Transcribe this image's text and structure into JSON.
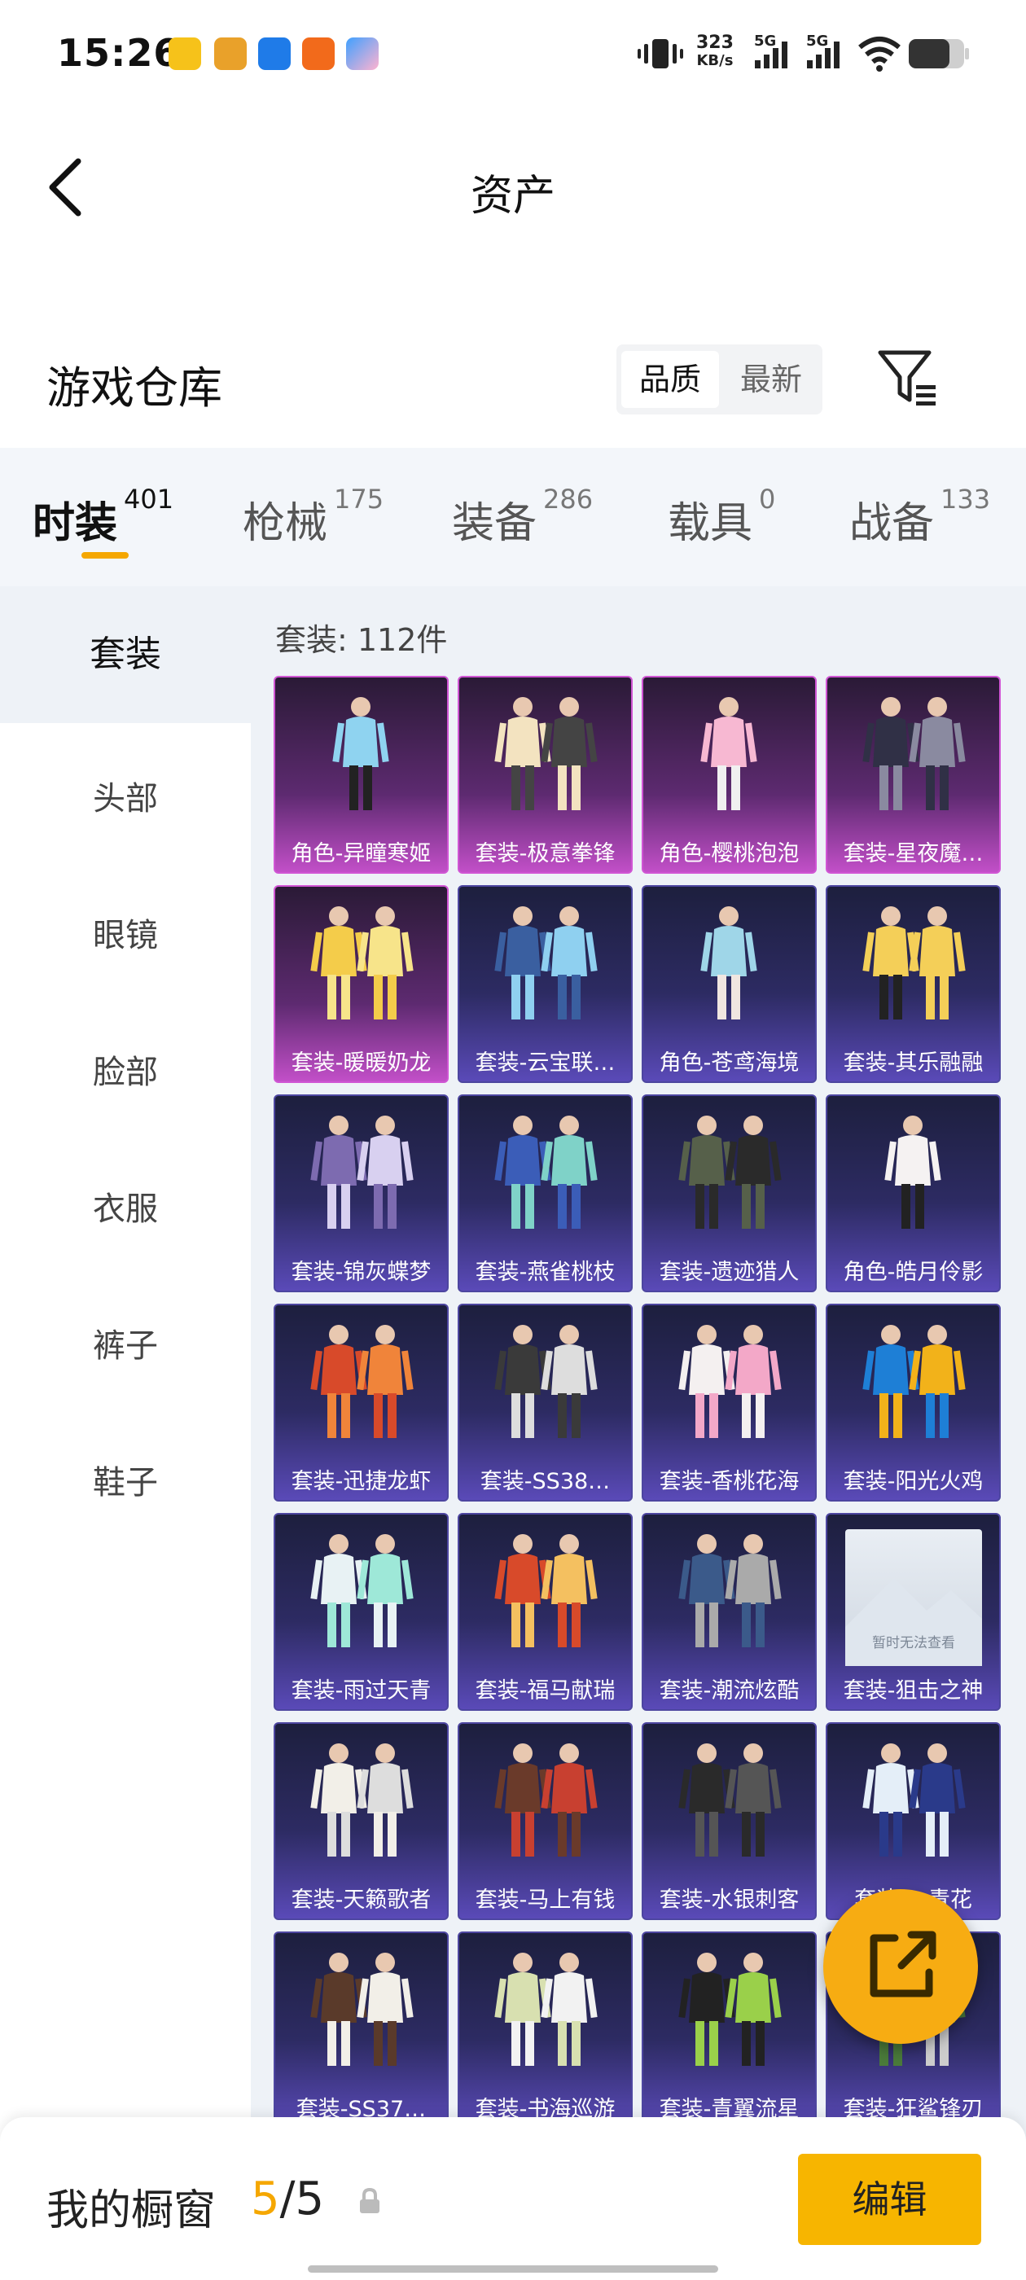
{
  "status_bar": {
    "time": "15:26",
    "net_speed_value": "323",
    "net_speed_unit": "KB/s",
    "sim1": "5G",
    "sim2": "5G",
    "app_icons": [
      "app-icon-yellow",
      "app-icon-game",
      "app-icon-blue",
      "app-icon-orange",
      "app-icon-baidu"
    ]
  },
  "header": {
    "back_icon": "chevron-left-icon",
    "title": "资产"
  },
  "section": {
    "title": "游戏仓库",
    "sort_options": [
      "品质",
      "最新"
    ],
    "sort_selected": "品质",
    "filter_icon": "filter-icon"
  },
  "category_tabs": [
    {
      "label": "时装",
      "count": "401"
    },
    {
      "label": "枪械",
      "count": "175"
    },
    {
      "label": "装备",
      "count": "286"
    },
    {
      "label": "载具",
      "count": "0"
    },
    {
      "label": "战备",
      "count": "133"
    }
  ],
  "selected_category": "时装",
  "sidebar": {
    "items": [
      "套装",
      "头部",
      "眼镜",
      "脸部",
      "衣服",
      "裤子",
      "鞋子"
    ],
    "selected": "套装"
  },
  "content": {
    "count_label": "套装: 112件",
    "placeholder_text": "暂时无法查看",
    "items": [
      {
        "name": "角色-异瞳寒姬",
        "rarity": "purple"
      },
      {
        "name": "套装-极意拳锋",
        "rarity": "purple"
      },
      {
        "name": "角色-樱桃泡泡",
        "rarity": "purple"
      },
      {
        "name": "套装-星夜魔…",
        "rarity": "purple"
      },
      {
        "name": "套装-暖暖奶龙",
        "rarity": "purple"
      },
      {
        "name": "套装-云宝联…",
        "rarity": "blue"
      },
      {
        "name": "角色-苍鸢海境",
        "rarity": "blue"
      },
      {
        "name": "套装-其乐融融",
        "rarity": "blue"
      },
      {
        "name": "套装-锦灰蝶梦",
        "rarity": "blue"
      },
      {
        "name": "套装-燕雀桃枝",
        "rarity": "blue"
      },
      {
        "name": "套装-遗迹猎人",
        "rarity": "blue"
      },
      {
        "name": "角色-皓月伶影",
        "rarity": "blue"
      },
      {
        "name": "套装-迅捷龙虾",
        "rarity": "blue"
      },
      {
        "name": "套装-SS38…",
        "rarity": "blue"
      },
      {
        "name": "套装-香桃花海",
        "rarity": "blue"
      },
      {
        "name": "套装-阳光火鸡",
        "rarity": "blue"
      },
      {
        "name": "套装-雨过天青",
        "rarity": "blue"
      },
      {
        "name": "套装-福马献瑞",
        "rarity": "blue"
      },
      {
        "name": "套装-潮流炫酷",
        "rarity": "blue"
      },
      {
        "name": "套装-狙击之神",
        "rarity": "blue"
      },
      {
        "name": "套装-天籁歌者",
        "rarity": "blue"
      },
      {
        "name": "套装-马上有钱",
        "rarity": "blue"
      },
      {
        "name": "套装-水银刺客",
        "rarity": "blue"
      },
      {
        "name": "套装-…青花",
        "rarity": "blue"
      },
      {
        "name": "套装-SS37…",
        "rarity": "blue"
      },
      {
        "name": "套装-书海巡游",
        "rarity": "blue"
      },
      {
        "name": "套装-青翼流星",
        "rarity": "blue"
      },
      {
        "name": "套装-狂鲨锋刃",
        "rarity": "blue"
      }
    ]
  },
  "fab": {
    "icon": "share-external-icon"
  },
  "bottom_bar": {
    "label": "我的橱窗",
    "current": "5",
    "separator": "/",
    "total": "5",
    "lock_icon": "lock-icon",
    "edit_label": "编辑"
  },
  "colors": {
    "accent": "#f7b500",
    "purple_card": "#c24fc8",
    "blue_card": "#5a4ab8"
  }
}
